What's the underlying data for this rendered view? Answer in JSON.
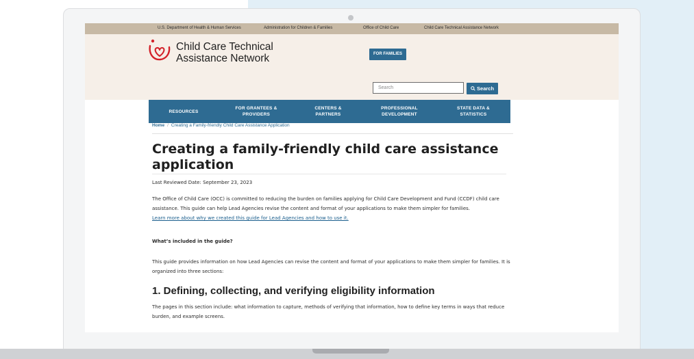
{
  "top_links": [
    "U.S. Department of Health & Human Services",
    "Administration for Children & Families",
    "Office of Child Care",
    "Child Care Technical Assistance Network"
  ],
  "logo": {
    "line1": "Child Care Technical",
    "line2": "Assistance Network"
  },
  "for_families_label": "FOR FAMILIES",
  "search": {
    "placeholder": "Search",
    "button_label": "Search"
  },
  "nav": [
    {
      "line1": "RESOURCES",
      "line2": ""
    },
    {
      "line1": "FOR GRANTEES &",
      "line2": "PROVIDERS"
    },
    {
      "line1": "CENTERS &",
      "line2": "PARTNERS"
    },
    {
      "line1": "PROFESSIONAL",
      "line2": "DEVELOPMENT"
    },
    {
      "line1": "STATE DATA &",
      "line2": "STATISTICS"
    }
  ],
  "breadcrumb": {
    "home": "Home",
    "separator": "/",
    "current": "Creating a Family-friendly Child Care Assistance Application"
  },
  "page_title": "Creating a family-friendly child care assistance application",
  "last_reviewed": "Last Reviewed Date:  September 23, 2023",
  "intro": {
    "text": "The Office of Child Care (OCC) is committed to reducing the burden on families applying for Child Care Development and Fund (CCDF) child care assistance. This guide can help Lead Agencies revise the content and format of your applications to make them simpler for families.",
    "link": "Learn more about why we created this guide for Lead Agencies and how to use it."
  },
  "whats_included": "What’s included in the guide?",
  "guide_text": "This guide provides information on how Lead Agencies can revise the content and format of your applications to make them simpler for families. It is organized into three sections:",
  "section1": {
    "heading": "1. Defining, collecting, and verifying eligibility information",
    "text": "The pages in this section include: what information to capture, methods of verifying that information, how to define key terms in ways that reduce burden, and example screens."
  },
  "colors": {
    "nav_blue": "#2e6b92",
    "top_bar": "#c7b9a5",
    "header_bg": "#f6efe8",
    "logo_red": "#d3222a",
    "background_accent": "#e2eff7"
  },
  "icons": {
    "search": "magnifier-icon",
    "logo": "heart-logo-icon"
  }
}
